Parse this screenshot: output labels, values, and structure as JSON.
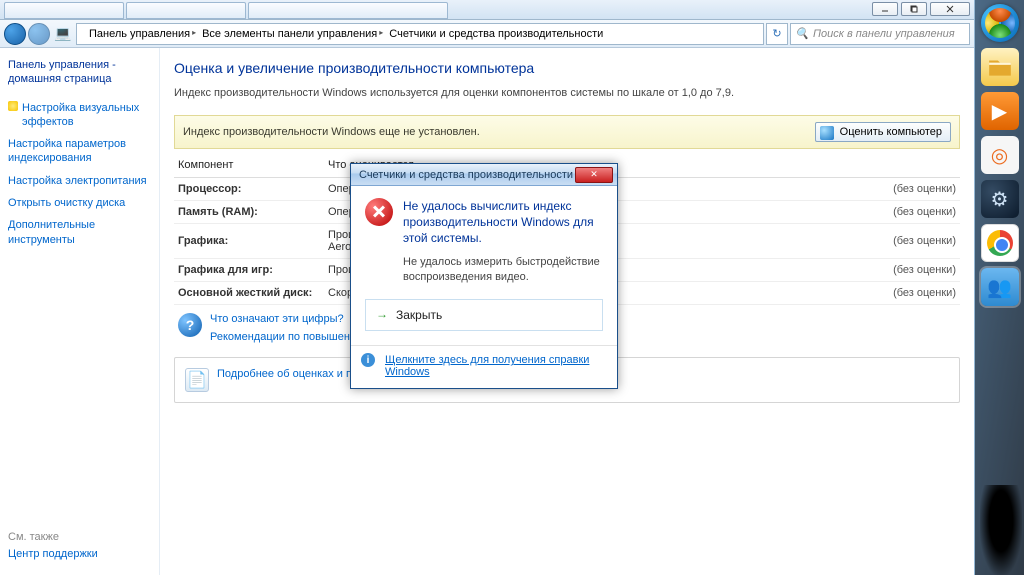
{
  "browser_tabs": [
    "",
    "",
    ""
  ],
  "breadcrumb": {
    "b1": "Панель управления",
    "b2": "Все элементы панели управления",
    "b3": "Счетчики и средства производительности"
  },
  "search_placeholder": "Поиск в панели управления",
  "sidebar": {
    "home": "Панель управления - домашняя страница",
    "links": [
      "Настройка визуальных эффектов",
      "Настройка параметров индексирования",
      "Настройка электропитания",
      "Открыть очистку диска",
      "Дополнительные инструменты"
    ],
    "see_also_label": "См. также",
    "support": "Центр поддержки"
  },
  "main": {
    "title": "Оценка и увеличение производительности компьютера",
    "desc": "Индекс производительности Windows используется для оценки компонентов системы по шкале от 1,0 до 7,9.",
    "notice": "Индекс производительности Windows еще не установлен.",
    "rate_button": "Оценить компьютер"
  },
  "table": {
    "h1": "Компонент",
    "h2": "Что оценивается",
    "h3": "",
    "rows": [
      {
        "c": "Процессор:",
        "d": "Операций вычи",
        "s": "(без оценки)"
      },
      {
        "c": "Память (RAM):",
        "d": "Операций досту",
        "s": "(без оценки)"
      },
      {
        "c": "Графика:",
        "d": "Производитель\nAero",
        "s": "(без оценки)"
      },
      {
        "c": "Графика для игр:",
        "d": "Производитель",
        "s": "(без оценки)"
      },
      {
        "c": "Основной жесткий диск:",
        "d": "Скорость обмен",
        "s": "(без оценки)"
      }
    ]
  },
  "info": {
    "q1": "Что означают эти цифры?",
    "q2": "Рекомендации по повышению производительности компьюте",
    "q3": "Подробнее об оценках и програ обеспечении (в Интернете)"
  },
  "dialog": {
    "title": "Счетчики и средства производительности",
    "head": "Не удалось вычислить индекс производительности Windows для этой системы.",
    "sub": "Не удалось измерить быстродействие воспроизведения видео.",
    "close": "Закрыть",
    "help": "Щелкните здесь для получения справки Windows"
  }
}
